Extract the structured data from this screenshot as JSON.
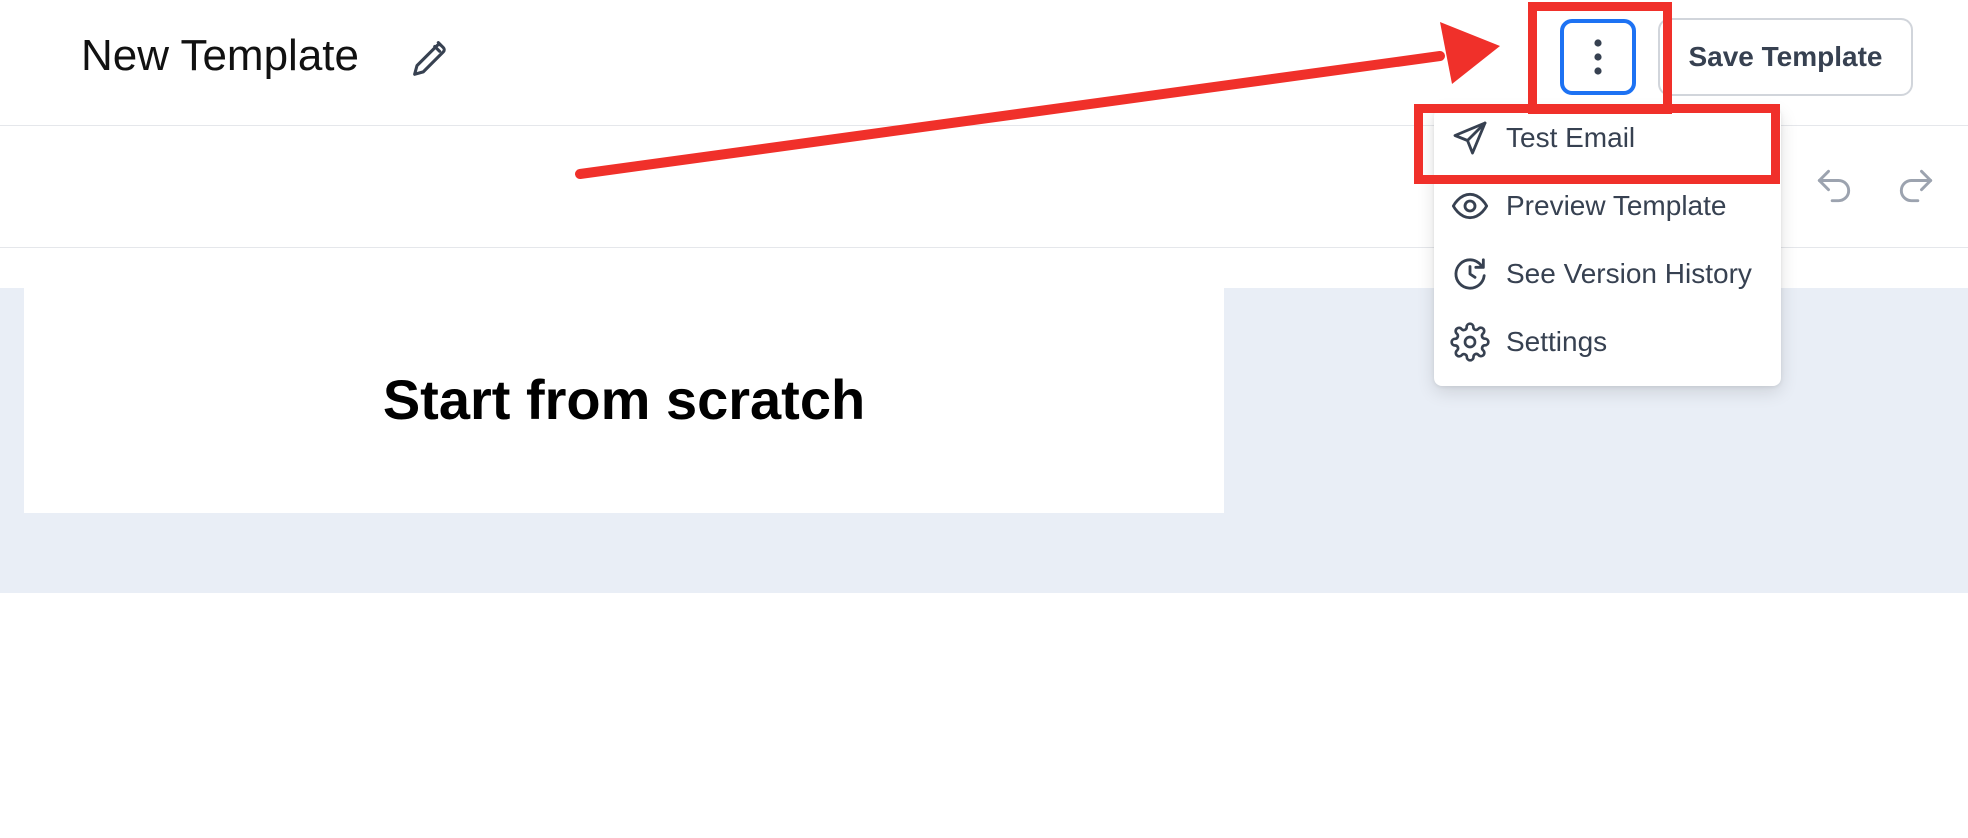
{
  "header": {
    "title": "New Template",
    "edit_icon": "pencil-icon",
    "more_icon": "vertical-dots-icon",
    "save_label": "Save Template"
  },
  "toolbar": {
    "undo_icon": "undo-icon",
    "redo_icon": "redo-icon"
  },
  "canvas": {
    "heading": "Start from scratch"
  },
  "menu": {
    "items": [
      {
        "label": "Test Email",
        "icon": "send-icon"
      },
      {
        "label": "Preview Template",
        "icon": "eye-icon"
      },
      {
        "label": "See Version History",
        "icon": "history-icon"
      },
      {
        "label": "Settings",
        "icon": "gear-icon"
      }
    ]
  },
  "annotation": {
    "color": "#f0302a"
  },
  "colors": {
    "accent": "#1d72f3",
    "canvas_background": "#e9eef6"
  }
}
